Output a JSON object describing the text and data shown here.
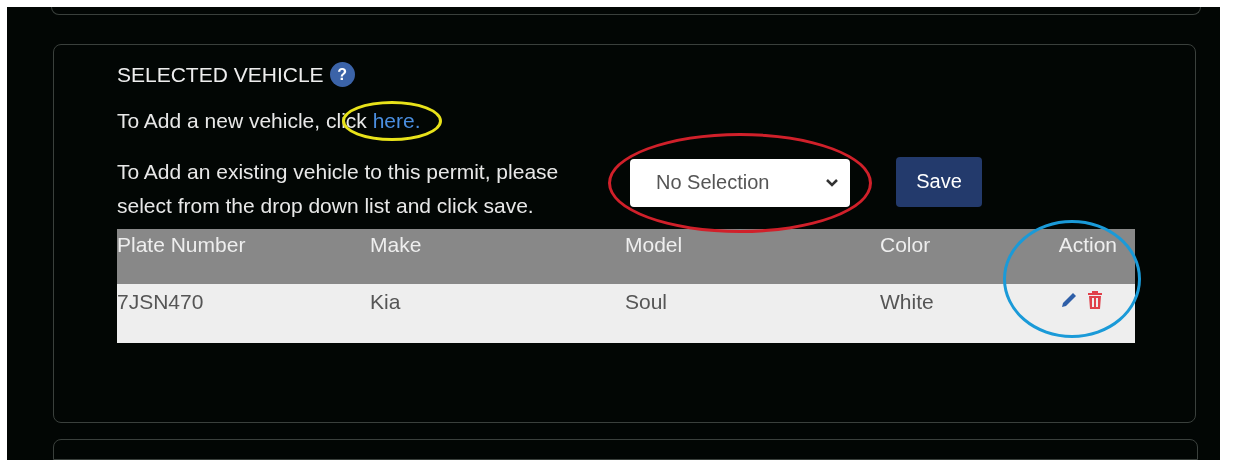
{
  "section": {
    "title": "SELECTED VEHICLE",
    "help_icon": "?",
    "new_vehicle": {
      "text": "To Add a new vehicle, click ",
      "link": "here.",
      "highlight": {
        "color": "#e8e21a"
      }
    },
    "existing_vehicle": {
      "text": "To Add an existing vehicle to this permit, please select from the drop down list and click save.",
      "select": {
        "value": "No Selection",
        "highlight": {
          "color": "#d0202a"
        }
      },
      "button": "Save"
    }
  },
  "table": {
    "columns": [
      "Plate Number",
      "Make",
      "Model",
      "Color",
      "Action"
    ],
    "action_highlight": {
      "color": "#1a9ad8"
    },
    "rows": [
      {
        "cells": [
          "7JSN470",
          "Kia",
          "Soul",
          "White"
        ]
      }
    ]
  }
}
